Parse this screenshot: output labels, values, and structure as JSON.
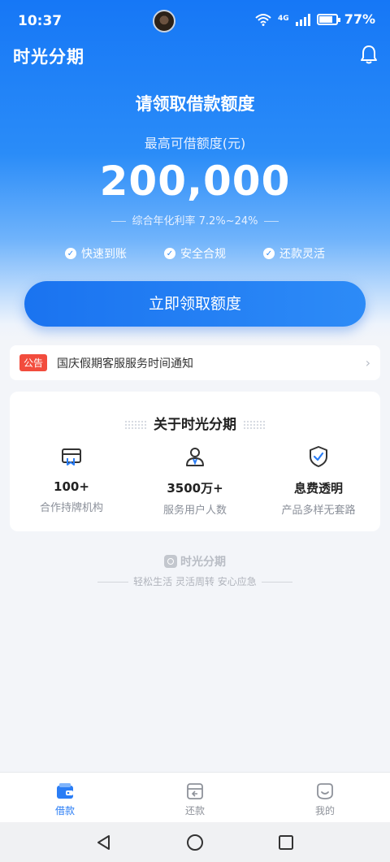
{
  "status_bar": {
    "time": "10:37",
    "battery": "77%",
    "network": "4G",
    "wifi_badge": "6"
  },
  "header": {
    "app_name": "时光分期",
    "notification_icon": "bell-icon"
  },
  "hero": {
    "title": "请领取借款额度",
    "max_label": "最高可借额度(元)",
    "amount": "200,000",
    "rate": "综合年化利率 7.2%~24%",
    "features": [
      "快速到账",
      "安全合规",
      "还款灵活"
    ],
    "cta_label": "立即领取额度"
  },
  "notice": {
    "badge": "公告",
    "text": "国庆假期客服服务时间通知",
    "arrow": "›"
  },
  "about": {
    "title": "关于时光分期",
    "stats": [
      {
        "icon": "card-icon",
        "value": "100+",
        "label": "合作持牌机构"
      },
      {
        "icon": "user-icon",
        "value": "3500万+",
        "label": "服务用户人数"
      },
      {
        "icon": "shield-check-icon",
        "value": "息费透明",
        "label": "产品多样无套路"
      }
    ]
  },
  "footer": {
    "brand": "时光分期",
    "slogan": "轻松生活 灵活周转 安心应急"
  },
  "tabbar": {
    "tabs": [
      {
        "label": "借款",
        "icon": "wallet-icon",
        "active": true
      },
      {
        "label": "还款",
        "icon": "bill-icon",
        "active": false
      },
      {
        "label": "我的",
        "icon": "smile-icon",
        "active": false
      }
    ]
  },
  "colors": {
    "primary": "#1677f6",
    "badge_red": "#f24c3d",
    "background": "#f3f5f9"
  }
}
